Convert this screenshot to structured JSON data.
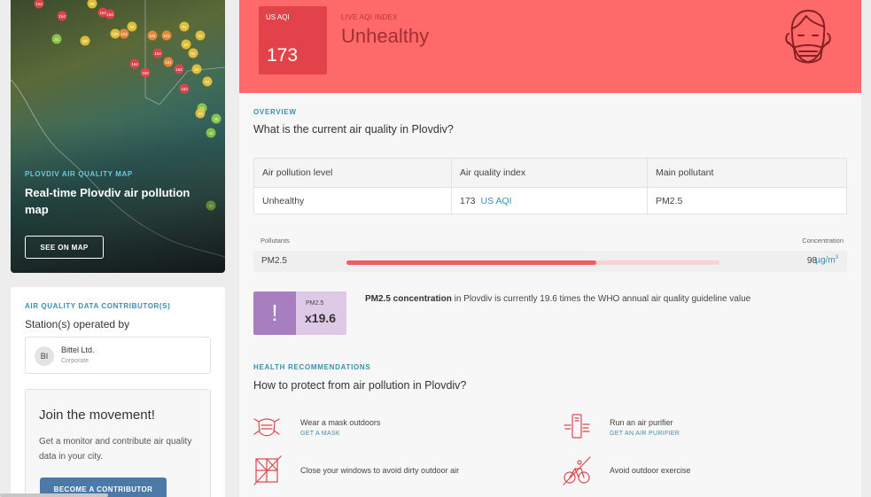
{
  "map_card": {
    "eyebrow": "PLOVDIV AIR QUALITY MAP",
    "title": "Real-time Plovdiv air pollution map",
    "button": "SEE ON MAP",
    "markers": [
      "164",
      "154",
      "99",
      "164",
      "154",
      "100",
      "64",
      "122",
      "99",
      "101",
      "101",
      "164",
      "154",
      "101",
      "154",
      "154",
      "154",
      "64",
      "64",
      "64",
      "54",
      "54",
      "54",
      "22",
      "22",
      "45",
      "43",
      "53",
      "22"
    ]
  },
  "contributor": {
    "eyebrow": "AIR QUALITY DATA CONTRIBUTOR(S)",
    "title": "Station(s) operated by",
    "station": {
      "initials": "BI",
      "name": "Bittel Ltd.",
      "type": "Corporate"
    },
    "movement": {
      "title": "Join the movement!",
      "text": "Get a monitor and contribute air quality data in your city.",
      "button": "BECOME A CONTRIBUTOR"
    }
  },
  "aqi": {
    "box_label": "US AQI",
    "value": "173",
    "live_label": "LIVE AQI INDEX",
    "status": "Unhealthy",
    "colors": {
      "banner": "#fe6a69",
      "box": "#e2434a",
      "text": "#a32f33"
    }
  },
  "overview": {
    "eyebrow": "OVERVIEW",
    "title": "What is the current air quality in Plovdiv?",
    "table": {
      "headers": [
        "Air pollution level",
        "Air quality index",
        "Main pollutant"
      ],
      "level": "Unhealthy",
      "index_value": "173",
      "index_unit": "US AQI",
      "main_pollutant": "PM2.5"
    }
  },
  "pollutants": {
    "header_left": "Pollutants",
    "header_right": "Concentration",
    "rows": [
      {
        "name": "PM2.5",
        "value": "98",
        "unit": "µg/m",
        "unit_sup": "3",
        "level_fraction": 0.67
      }
    ]
  },
  "who": {
    "label": "PM2.5",
    "multiplier": "x19.6",
    "icon": "!",
    "text_bold": "PM2.5 concentration",
    "text_rest": " in Plovdiv is currently 19.6 times the WHO annual air quality guideline value"
  },
  "health": {
    "eyebrow": "HEALTH RECOMMENDATIONS",
    "title": "How to protect from air pollution in Plovdiv?",
    "items": [
      {
        "icon": "mask-icon",
        "text": "Wear a mask outdoors",
        "link": "GET A MASK"
      },
      {
        "icon": "air-purifier-icon",
        "text": "Run an air purifier",
        "link": "GET AN AIR PURIFIER"
      },
      {
        "icon": "closed-window-icon",
        "text": "Close your windows to avoid dirty outdoor air",
        "link": ""
      },
      {
        "icon": "no-cycling-icon",
        "text": "Avoid outdoor exercise",
        "link": ""
      }
    ]
  }
}
